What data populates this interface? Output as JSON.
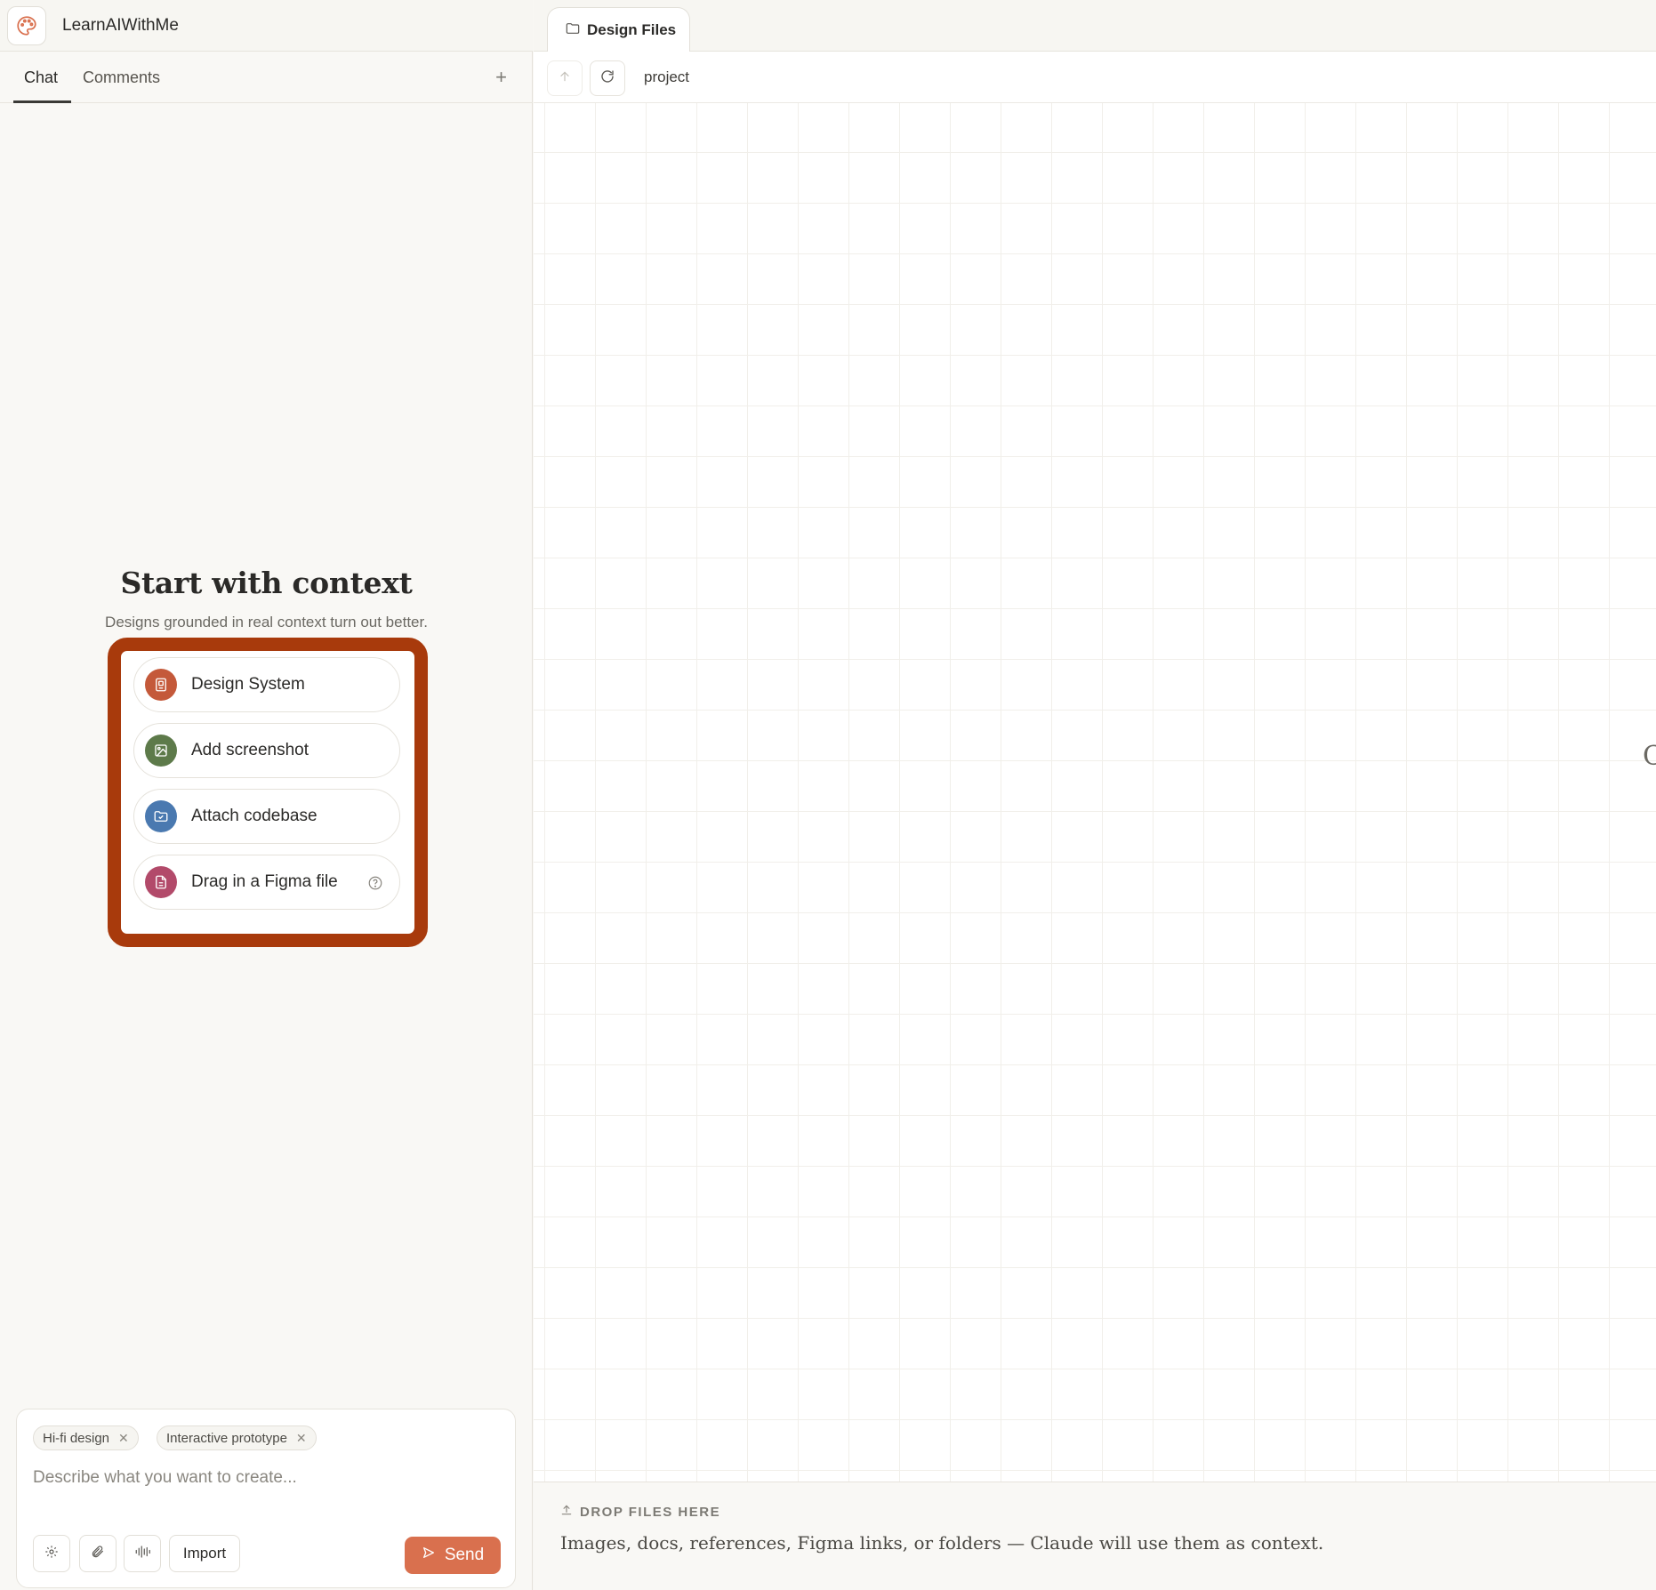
{
  "app": {
    "title": "LearnAIWithMe",
    "icon": "palette-icon",
    "accent": "#d9704e"
  },
  "left_tabs": [
    {
      "label": "Chat",
      "active": true
    },
    {
      "label": "Comments",
      "active": false
    }
  ],
  "new_tab_label": "+",
  "context": {
    "title": "Start with context",
    "subtitle": "Designs grounded in real context turn out better.",
    "highlight_color": "#a83a0c",
    "options": [
      {
        "label": "Design System",
        "icon": "design-system-icon",
        "color": "#c4593a"
      },
      {
        "label": "Add screenshot",
        "icon": "image-icon",
        "color": "#5d7a4a"
      },
      {
        "label": "Attach codebase",
        "icon": "folder-code-icon",
        "color": "#4a79b0"
      },
      {
        "label": "Drag in a Figma file",
        "icon": "file-icon",
        "color": "#b24a6a",
        "help_icon": "question-circle-icon"
      }
    ]
  },
  "composer": {
    "chips": [
      {
        "label": "Hi-fi design"
      },
      {
        "label": "Interactive prototype"
      }
    ],
    "placeholder": "Describe what you want to create...",
    "import_label": "Import",
    "send_label": "Send"
  },
  "right": {
    "tab_label": "Design Files",
    "path": "project",
    "edge_glyph": "C",
    "drop_heading": "DROP FILES HERE",
    "drop_text": "Images, docs, references, Figma links, or folders — Claude will use them as context."
  }
}
